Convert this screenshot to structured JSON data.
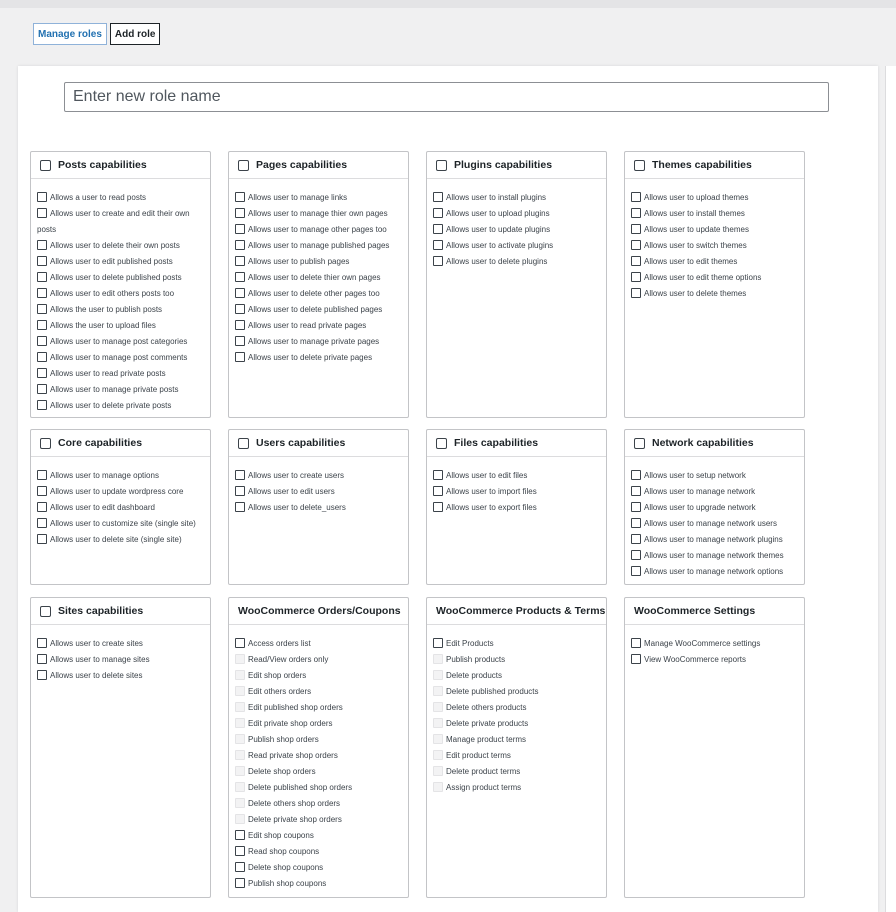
{
  "tabs": {
    "manage_roles": "Manage roles",
    "add_role": "Add role"
  },
  "role_name": {
    "placeholder": "Enter new role name",
    "value": ""
  },
  "cards": [
    {
      "id": "posts",
      "title": "Posts capabilities",
      "header_checkbox": true,
      "items": [
        {
          "label": "Allows a user to read posts",
          "disabled": false
        },
        {
          "label": "Allows user to create and edit their own posts",
          "disabled": false
        },
        {
          "label": "Allows user to delete their own posts",
          "disabled": false
        },
        {
          "label": "Allows user to edit published posts",
          "disabled": false
        },
        {
          "label": "Allows user to delete published posts",
          "disabled": false
        },
        {
          "label": "Allows user to edit others posts too",
          "disabled": false
        },
        {
          "label": "Allows the user to publish posts",
          "disabled": false
        },
        {
          "label": "Allows the user to upload files",
          "disabled": false
        },
        {
          "label": "Allows user to manage post categories",
          "disabled": false
        },
        {
          "label": "Allows user to manage post comments",
          "disabled": false
        },
        {
          "label": "Allows user to read private posts",
          "disabled": false
        },
        {
          "label": "Allows user to manage private posts",
          "disabled": false
        },
        {
          "label": "Allows user to delete private posts",
          "disabled": false
        }
      ]
    },
    {
      "id": "pages",
      "title": "Pages capabilities",
      "header_checkbox": true,
      "items": [
        {
          "label": "Allows user to manage links",
          "disabled": false
        },
        {
          "label": "Allows user to manage thier own pages",
          "disabled": false
        },
        {
          "label": "Allows user to manage other pages too",
          "disabled": false
        },
        {
          "label": "Allows user to manage published pages",
          "disabled": false
        },
        {
          "label": "Allows user to publish pages",
          "disabled": false
        },
        {
          "label": "Allows user to delete thier own pages",
          "disabled": false
        },
        {
          "label": "Allows user to delete other pages too",
          "disabled": false
        },
        {
          "label": "Allows user to delete published pages",
          "disabled": false
        },
        {
          "label": "Allows user to read private pages",
          "disabled": false
        },
        {
          "label": "Allows user to manage private pages",
          "disabled": false
        },
        {
          "label": "Allows user to delete private pages",
          "disabled": false
        }
      ]
    },
    {
      "id": "plugins",
      "title": "Plugins capabilities",
      "header_checkbox": true,
      "items": [
        {
          "label": "Allows user to install plugins",
          "disabled": false
        },
        {
          "label": "Allows user to upload plugins",
          "disabled": false
        },
        {
          "label": "Allows user to update plugins",
          "disabled": false
        },
        {
          "label": "Allows user to activate plugins",
          "disabled": false
        },
        {
          "label": "Allows user to delete plugins",
          "disabled": false
        }
      ]
    },
    {
      "id": "themes",
      "title": "Themes capabilities",
      "header_checkbox": true,
      "items": [
        {
          "label": "Allows user to upload themes",
          "disabled": false
        },
        {
          "label": "Allows user to install themes",
          "disabled": false
        },
        {
          "label": "Allows user to update themes",
          "disabled": false
        },
        {
          "label": "Allows user to switch themes",
          "disabled": false
        },
        {
          "label": "Allows user to edit themes",
          "disabled": false
        },
        {
          "label": "Allows user to edit theme options",
          "disabled": false
        },
        {
          "label": "Allows user to delete themes",
          "disabled": false
        }
      ]
    },
    {
      "id": "core",
      "title": "Core capabilities",
      "header_checkbox": true,
      "items": [
        {
          "label": "Allows user to manage options",
          "disabled": false
        },
        {
          "label": "Allows user to update wordpress core",
          "disabled": false
        },
        {
          "label": "Allows user to edit dashboard",
          "disabled": false
        },
        {
          "label": "Allows user to customize site (single site)",
          "disabled": false
        },
        {
          "label": "Allows user to delete site (single site)",
          "disabled": false
        }
      ]
    },
    {
      "id": "users",
      "title": "Users capabilities",
      "header_checkbox": true,
      "items": [
        {
          "label": "Allows user to create users",
          "disabled": false
        },
        {
          "label": "Allows user to edit users",
          "disabled": false
        },
        {
          "label": "Allows user to delete_users",
          "disabled": false
        }
      ]
    },
    {
      "id": "files",
      "title": "Files capabilities",
      "header_checkbox": true,
      "items": [
        {
          "label": "Allows user to edit files",
          "disabled": false
        },
        {
          "label": "Allows user to import files",
          "disabled": false
        },
        {
          "label": "Allows user to export files",
          "disabled": false
        }
      ]
    },
    {
      "id": "network",
      "title": "Network capabilities",
      "header_checkbox": true,
      "items": [
        {
          "label": "Allows user to setup network",
          "disabled": false
        },
        {
          "label": "Allows user to manage network",
          "disabled": false
        },
        {
          "label": "Allows user to upgrade network",
          "disabled": false
        },
        {
          "label": "Allows user to manage network users",
          "disabled": false
        },
        {
          "label": "Allows user to manage network plugins",
          "disabled": false
        },
        {
          "label": "Allows user to manage network themes",
          "disabled": false
        },
        {
          "label": "Allows user to manage network options",
          "disabled": false
        }
      ]
    },
    {
      "id": "sites",
      "title": "Sites capabilities",
      "header_checkbox": true,
      "items": [
        {
          "label": "Allows user to create sites",
          "disabled": false
        },
        {
          "label": "Allows user to manage sites",
          "disabled": false
        },
        {
          "label": "Allows user to delete sites",
          "disabled": false
        }
      ]
    },
    {
      "id": "woo-orders",
      "title": "WooCommerce Orders/Coupons",
      "header_checkbox": false,
      "items": [
        {
          "label": "Access orders list",
          "disabled": false
        },
        {
          "label": "Read/View orders only",
          "disabled": true
        },
        {
          "label": "Edit shop orders",
          "disabled": true
        },
        {
          "label": "Edit others orders",
          "disabled": true
        },
        {
          "label": "Edit published shop orders",
          "disabled": true
        },
        {
          "label": "Edit private shop orders",
          "disabled": true
        },
        {
          "label": "Publish shop orders",
          "disabled": true
        },
        {
          "label": "Read private shop orders",
          "disabled": true
        },
        {
          "label": "Delete shop orders",
          "disabled": true
        },
        {
          "label": "Delete published shop orders",
          "disabled": true
        },
        {
          "label": "Delete others shop orders",
          "disabled": true
        },
        {
          "label": "Delete private shop orders",
          "disabled": true
        },
        {
          "label": "Edit shop coupons",
          "disabled": false
        },
        {
          "label": "Read shop coupons",
          "disabled": false
        },
        {
          "label": "Delete shop coupons",
          "disabled": false
        },
        {
          "label": "Publish shop coupons",
          "disabled": false
        }
      ]
    },
    {
      "id": "woo-products",
      "title": "WooCommerce Products & Terms",
      "header_checkbox": false,
      "items": [
        {
          "label": "Edit Products",
          "disabled": false
        },
        {
          "label": "Publish products",
          "disabled": true
        },
        {
          "label": "Delete products",
          "disabled": true
        },
        {
          "label": "Delete published products",
          "disabled": true
        },
        {
          "label": "Delete others products",
          "disabled": true
        },
        {
          "label": "Delete private products",
          "disabled": true
        },
        {
          "label": "Manage product terms",
          "disabled": true
        },
        {
          "label": "Edit product terms",
          "disabled": true
        },
        {
          "label": "Delete product terms",
          "disabled": true
        },
        {
          "label": "Assign product terms",
          "disabled": true
        }
      ]
    },
    {
      "id": "woo-settings",
      "title": "WooCommerce Settings",
      "header_checkbox": false,
      "items": [
        {
          "label": "Manage WooCommerce settings",
          "disabled": false
        },
        {
          "label": "View WooCommerce reports",
          "disabled": false
        }
      ]
    }
  ]
}
